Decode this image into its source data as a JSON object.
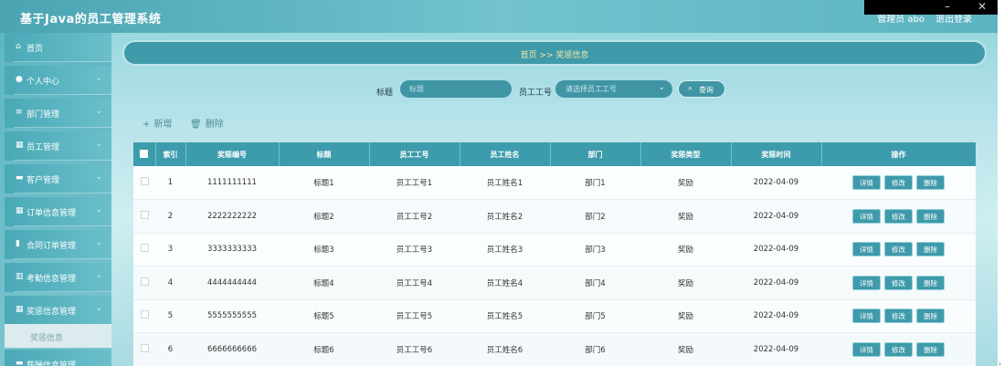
{
  "header": {
    "title": "基于Java的员工管理系统",
    "user": "管理员 abo",
    "logout": "退出登录"
  },
  "window_controls": {
    "minimize": "–",
    "close": "✕"
  },
  "sidebar": {
    "items": [
      {
        "label": "首页",
        "icon": "home-icon",
        "glyph": "⌂"
      },
      {
        "label": "个人中心",
        "icon": "user-icon",
        "glyph": "●"
      },
      {
        "label": "部门管理",
        "icon": "list-icon",
        "glyph": "≡"
      },
      {
        "label": "员工管理",
        "icon": "grid-icon",
        "glyph": "▦"
      },
      {
        "label": "客户管理",
        "icon": "chat-icon",
        "glyph": "▬"
      },
      {
        "label": "订单信息管理",
        "icon": "grid-icon",
        "glyph": "▦"
      },
      {
        "label": "合同订单管理",
        "icon": "document-icon",
        "glyph": "▮"
      },
      {
        "label": "考勤信息管理",
        "icon": "bar-chart-icon",
        "glyph": "▥"
      },
      {
        "label": "奖惩信息管理",
        "icon": "grid-icon",
        "glyph": "▦"
      }
    ],
    "sub_item": "奖惩信息",
    "partial_item": "薪酬信息管理"
  },
  "breadcrumb": {
    "text": "首页 >> 奖惩信息"
  },
  "search": {
    "title_label": "标题",
    "title_placeholder": "标题",
    "emp_label": "员工工号",
    "emp_placeholder": "请选择员工工号",
    "query_label": "查询"
  },
  "actions": {
    "add": "新增",
    "delete": "删除"
  },
  "table": {
    "columns": [
      "索引",
      "奖惩编号",
      "标题",
      "员工工号",
      "员工姓名",
      "部门",
      "奖惩类型",
      "奖惩时间",
      "操作"
    ],
    "rows": [
      {
        "idx": "1",
        "code": "1111111111",
        "title": "标题1",
        "emp_no": "员工工号1",
        "emp_name": "员工姓名1",
        "dept": "部门1",
        "type": "奖励",
        "date": "2022-04-09"
      },
      {
        "idx": "2",
        "code": "2222222222",
        "title": "标题2",
        "emp_no": "员工工号2",
        "emp_name": "员工姓名2",
        "dept": "部门2",
        "type": "奖励",
        "date": "2022-04-09"
      },
      {
        "idx": "3",
        "code": "3333333333",
        "title": "标题3",
        "emp_no": "员工工号3",
        "emp_name": "员工姓名3",
        "dept": "部门3",
        "type": "奖励",
        "date": "2022-04-09"
      },
      {
        "idx": "4",
        "code": "4444444444",
        "title": "标题4",
        "emp_no": "员工工号4",
        "emp_name": "员工姓名4",
        "dept": "部门4",
        "type": "奖励",
        "date": "2022-04-09"
      },
      {
        "idx": "5",
        "code": "5555555555",
        "title": "标题5",
        "emp_no": "员工工号5",
        "emp_name": "员工姓名5",
        "dept": "部门5",
        "type": "奖励",
        "date": "2022-04-09"
      },
      {
        "idx": "6",
        "code": "6666666666",
        "title": "标题6",
        "emp_no": "员工工号6",
        "emp_name": "员工姓名6",
        "dept": "部门6",
        "type": "奖励",
        "date": "2022-04-09"
      }
    ],
    "op_labels": {
      "detail": "详情",
      "edit": "修改",
      "remove": "删除"
    }
  },
  "colors": {
    "accent": "#3f9aaa",
    "header": "#5cb3c1",
    "breadcrumb_text": "#f5e9a6"
  }
}
